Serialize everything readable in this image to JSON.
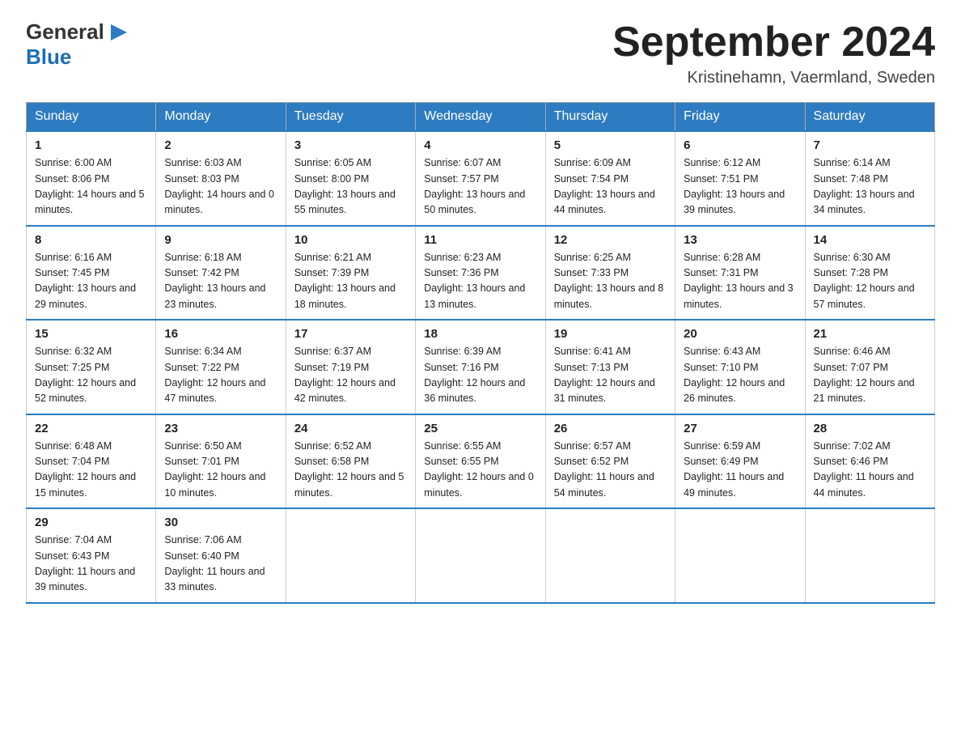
{
  "header": {
    "logo_general": "General",
    "logo_blue": "Blue",
    "month_title": "September 2024",
    "location": "Kristinehamn, Vaermland, Sweden"
  },
  "weekdays": [
    "Sunday",
    "Monday",
    "Tuesday",
    "Wednesday",
    "Thursday",
    "Friday",
    "Saturday"
  ],
  "weeks": [
    [
      {
        "day": "1",
        "sunrise": "6:00 AM",
        "sunset": "8:06 PM",
        "daylight": "14 hours and 5 minutes."
      },
      {
        "day": "2",
        "sunrise": "6:03 AM",
        "sunset": "8:03 PM",
        "daylight": "14 hours and 0 minutes."
      },
      {
        "day": "3",
        "sunrise": "6:05 AM",
        "sunset": "8:00 PM",
        "daylight": "13 hours and 55 minutes."
      },
      {
        "day": "4",
        "sunrise": "6:07 AM",
        "sunset": "7:57 PM",
        "daylight": "13 hours and 50 minutes."
      },
      {
        "day": "5",
        "sunrise": "6:09 AM",
        "sunset": "7:54 PM",
        "daylight": "13 hours and 44 minutes."
      },
      {
        "day": "6",
        "sunrise": "6:12 AM",
        "sunset": "7:51 PM",
        "daylight": "13 hours and 39 minutes."
      },
      {
        "day": "7",
        "sunrise": "6:14 AM",
        "sunset": "7:48 PM",
        "daylight": "13 hours and 34 minutes."
      }
    ],
    [
      {
        "day": "8",
        "sunrise": "6:16 AM",
        "sunset": "7:45 PM",
        "daylight": "13 hours and 29 minutes."
      },
      {
        "day": "9",
        "sunrise": "6:18 AM",
        "sunset": "7:42 PM",
        "daylight": "13 hours and 23 minutes."
      },
      {
        "day": "10",
        "sunrise": "6:21 AM",
        "sunset": "7:39 PM",
        "daylight": "13 hours and 18 minutes."
      },
      {
        "day": "11",
        "sunrise": "6:23 AM",
        "sunset": "7:36 PM",
        "daylight": "13 hours and 13 minutes."
      },
      {
        "day": "12",
        "sunrise": "6:25 AM",
        "sunset": "7:33 PM",
        "daylight": "13 hours and 8 minutes."
      },
      {
        "day": "13",
        "sunrise": "6:28 AM",
        "sunset": "7:31 PM",
        "daylight": "13 hours and 3 minutes."
      },
      {
        "day": "14",
        "sunrise": "6:30 AM",
        "sunset": "7:28 PM",
        "daylight": "12 hours and 57 minutes."
      }
    ],
    [
      {
        "day": "15",
        "sunrise": "6:32 AM",
        "sunset": "7:25 PM",
        "daylight": "12 hours and 52 minutes."
      },
      {
        "day": "16",
        "sunrise": "6:34 AM",
        "sunset": "7:22 PM",
        "daylight": "12 hours and 47 minutes."
      },
      {
        "day": "17",
        "sunrise": "6:37 AM",
        "sunset": "7:19 PM",
        "daylight": "12 hours and 42 minutes."
      },
      {
        "day": "18",
        "sunrise": "6:39 AM",
        "sunset": "7:16 PM",
        "daylight": "12 hours and 36 minutes."
      },
      {
        "day": "19",
        "sunrise": "6:41 AM",
        "sunset": "7:13 PM",
        "daylight": "12 hours and 31 minutes."
      },
      {
        "day": "20",
        "sunrise": "6:43 AM",
        "sunset": "7:10 PM",
        "daylight": "12 hours and 26 minutes."
      },
      {
        "day": "21",
        "sunrise": "6:46 AM",
        "sunset": "7:07 PM",
        "daylight": "12 hours and 21 minutes."
      }
    ],
    [
      {
        "day": "22",
        "sunrise": "6:48 AM",
        "sunset": "7:04 PM",
        "daylight": "12 hours and 15 minutes."
      },
      {
        "day": "23",
        "sunrise": "6:50 AM",
        "sunset": "7:01 PM",
        "daylight": "12 hours and 10 minutes."
      },
      {
        "day": "24",
        "sunrise": "6:52 AM",
        "sunset": "6:58 PM",
        "daylight": "12 hours and 5 minutes."
      },
      {
        "day": "25",
        "sunrise": "6:55 AM",
        "sunset": "6:55 PM",
        "daylight": "12 hours and 0 minutes."
      },
      {
        "day": "26",
        "sunrise": "6:57 AM",
        "sunset": "6:52 PM",
        "daylight": "11 hours and 54 minutes."
      },
      {
        "day": "27",
        "sunrise": "6:59 AM",
        "sunset": "6:49 PM",
        "daylight": "11 hours and 49 minutes."
      },
      {
        "day": "28",
        "sunrise": "7:02 AM",
        "sunset": "6:46 PM",
        "daylight": "11 hours and 44 minutes."
      }
    ],
    [
      {
        "day": "29",
        "sunrise": "7:04 AM",
        "sunset": "6:43 PM",
        "daylight": "11 hours and 39 minutes."
      },
      {
        "day": "30",
        "sunrise": "7:06 AM",
        "sunset": "6:40 PM",
        "daylight": "11 hours and 33 minutes."
      },
      null,
      null,
      null,
      null,
      null
    ]
  ]
}
